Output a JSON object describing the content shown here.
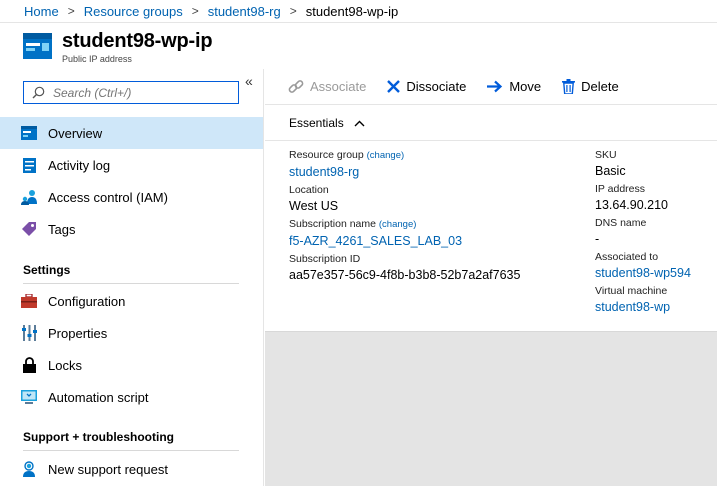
{
  "breadcrumb": {
    "items": [
      "Home",
      "Resource groups",
      "student98-rg"
    ],
    "current": "student98-wp-ip"
  },
  "header": {
    "title": "student98-wp-ip",
    "subtitle": "Public IP address"
  },
  "sidebar": {
    "search_placeholder": "Search (Ctrl+/)",
    "collapse_glyph": "«",
    "items": [
      {
        "label": "Overview",
        "icon": "overview-icon"
      },
      {
        "label": "Activity log",
        "icon": "activity-log-icon"
      },
      {
        "label": "Access control (IAM)",
        "icon": "iam-icon"
      },
      {
        "label": "Tags",
        "icon": "tag-icon"
      }
    ],
    "settings_title": "Settings",
    "settings_items": [
      {
        "label": "Configuration",
        "icon": "toolbox-icon"
      },
      {
        "label": "Properties",
        "icon": "properties-icon"
      },
      {
        "label": "Locks",
        "icon": "lock-icon"
      },
      {
        "label": "Automation script",
        "icon": "automation-script-icon"
      }
    ],
    "support_title": "Support + troubleshooting",
    "support_items": [
      {
        "label": "New support request",
        "icon": "support-person-icon"
      }
    ]
  },
  "toolbar": {
    "associate": "Associate",
    "dissociate": "Dissociate",
    "move": "Move",
    "delete": "Delete"
  },
  "essentials": {
    "title": "Essentials",
    "change": "(change)",
    "left": {
      "resource_group_label": "Resource group",
      "resource_group_value": "student98-rg",
      "location_label": "Location",
      "location_value": "West US",
      "subscription_name_label": "Subscription name",
      "subscription_name_value": "f5-AZR_4261_SALES_LAB_03",
      "subscription_id_label": "Subscription ID",
      "subscription_id_value": "aa57e357-56c9-4f8b-b3b8-52b7a2af7635"
    },
    "right": {
      "sku_label": "SKU",
      "sku_value": "Basic",
      "ip_label": "IP address",
      "ip_value": "13.64.90.210",
      "dns_label": "DNS name",
      "dns_value": "-",
      "associated_label": "Associated to",
      "associated_value": "student98-wp594",
      "vm_label": "Virtual machine",
      "vm_value": "student98-wp"
    }
  },
  "colors": {
    "link": "#0063b1",
    "active_nav": "#cfe7f9",
    "azure_blue": "#0072c6"
  }
}
